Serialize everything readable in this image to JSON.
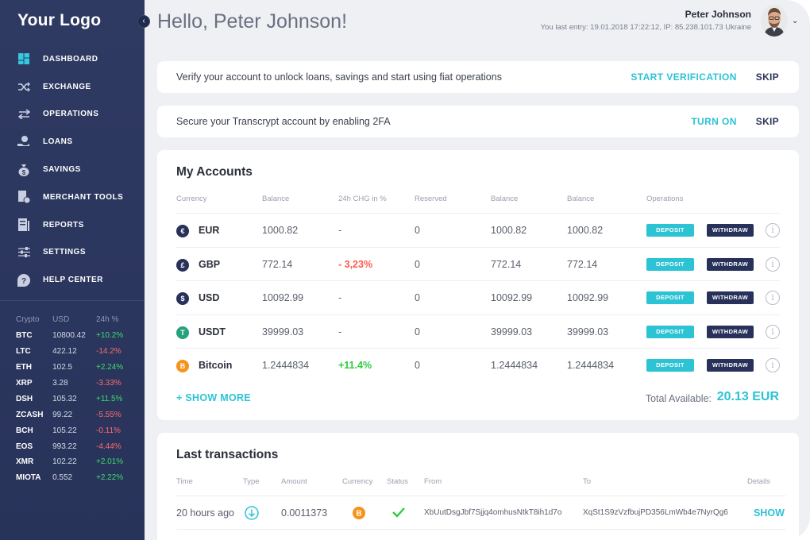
{
  "sidebar": {
    "logo": "Your Logo",
    "items": [
      {
        "label": "DASHBOARD",
        "icon": "dashboard-icon"
      },
      {
        "label": "EXCHANGE",
        "icon": "shuffle-icon"
      },
      {
        "label": "OPERATIONS",
        "icon": "arrows-icon"
      },
      {
        "label": "LOANS",
        "icon": "hand-coin-icon"
      },
      {
        "label": "SAVINGS",
        "icon": "money-bag-icon"
      },
      {
        "label": "MERCHANT TOOLS",
        "icon": "merchant-icon"
      },
      {
        "label": "REPORTS",
        "icon": "report-icon"
      },
      {
        "label": "SETTINGS",
        "icon": "sliders-icon"
      },
      {
        "label": "HELP CENTER",
        "icon": "help-icon"
      }
    ],
    "crypto_headers": {
      "c1": "Crypto",
      "c2": "USD",
      "c3": "24h %"
    },
    "crypto": [
      {
        "name": "BTC",
        "usd": "10800.42",
        "change": "+10.2%",
        "dir": "up"
      },
      {
        "name": "LTC",
        "usd": "422.12",
        "change": "-14.2%",
        "dir": "down"
      },
      {
        "name": "ETH",
        "usd": "102.5",
        "change": "+2.24%",
        "dir": "up"
      },
      {
        "name": "XRP",
        "usd": "3.28",
        "change": "-3.33%",
        "dir": "down"
      },
      {
        "name": "DSH",
        "usd": "105.32",
        "change": "+11.5%",
        "dir": "up"
      },
      {
        "name": "ZCASH",
        "usd": "99.22",
        "change": "-5.55%",
        "dir": "down"
      },
      {
        "name": "BCH",
        "usd": "105.22",
        "change": "-0.11%",
        "dir": "down"
      },
      {
        "name": "EOS",
        "usd": "993.22",
        "change": "-4.44%",
        "dir": "down"
      },
      {
        "name": "XMR",
        "usd": "102.22",
        "change": "+2.01%",
        "dir": "up"
      },
      {
        "name": "MIOTA",
        "usd": "0.552",
        "change": "+2.22%",
        "dir": "up"
      }
    ]
  },
  "header": {
    "greeting": "Hello, Peter Johnson!",
    "user_name": "Peter Johnson",
    "last_entry": "You last entry: 19.01.2018 17:22:12, IP: 85.238.101.73 Ukraine"
  },
  "banners": {
    "verify": {
      "message": "Verify your account to unlock loans, savings and start using fiat operations",
      "action": "START VERIFICATION",
      "skip": "SKIP"
    },
    "twofa": {
      "message": "Secure your Transcrypt account by enabling 2FA",
      "action": "TURN ON",
      "skip": "SKIP"
    }
  },
  "accounts": {
    "title": "My Accounts",
    "headers": [
      "Currency",
      "Balance",
      "24h CHG in %",
      "Reserved",
      "Balance",
      "Balance",
      "Operations"
    ],
    "deposit_label": "DEPOSIT",
    "withdraw_label": "WITHDRAW",
    "rows": [
      {
        "symbol": "€",
        "icon_color": "#27315a",
        "name": "EUR",
        "balance": "1000.82",
        "change": "-",
        "change_dir": "none",
        "reserved": "0",
        "balance2": "1000.82",
        "balance3": "1000.82"
      },
      {
        "symbol": "£",
        "icon_color": "#27315a",
        "name": "GBP",
        "balance": "772.14",
        "change": "- 3,23%",
        "change_dir": "down",
        "reserved": "0",
        "balance2": "772.14",
        "balance3": "772.14"
      },
      {
        "symbol": "$",
        "icon_color": "#27315a",
        "name": "USD",
        "balance": "10092.99",
        "change": "-",
        "change_dir": "none",
        "reserved": "0",
        "balance2": "10092.99",
        "balance3": "10092.99"
      },
      {
        "symbol": "T",
        "icon_color": "#26a17b",
        "name": "USDT",
        "balance": "39999.03",
        "change": "-",
        "change_dir": "none",
        "reserved": "0",
        "balance2": "39999.03",
        "balance3": "39999.03"
      },
      {
        "symbol": "B",
        "icon_color": "#f7931a",
        "name": "Bitcoin",
        "balance": "1.2444834",
        "change": "+11.4%",
        "change_dir": "up",
        "reserved": "0",
        "balance2": "1.2444834",
        "balance3": "1.2444834"
      }
    ],
    "show_more": "+ SHOW MORE",
    "total_label": "Total Available:",
    "total_value": "20.13 EUR"
  },
  "transactions": {
    "title": "Last transactions",
    "headers": [
      "Time",
      "Type",
      "Amount",
      "Currency",
      "Status",
      "From",
      "To",
      "Details"
    ],
    "rows": [
      {
        "time": "20 hours ago",
        "type_icon": "arrow-down-circle-icon",
        "amount": "0.0011373",
        "currency_icon": "bitcoin-icon",
        "status_icon": "check-icon",
        "from": "XbUutDsgJbf7Sjjq4omhusNtkT8ih1d7o",
        "to": "XqSt1S9zVzfbujPD356LmWb4e7NyrQg6",
        "details": "SHOW"
      }
    ]
  },
  "colors": {
    "accent": "#2cc3d5",
    "sidebar": "#2f3a63",
    "dark_button": "#27315a",
    "positive": "#3ddc6b",
    "negative": "#ff6b6b"
  }
}
